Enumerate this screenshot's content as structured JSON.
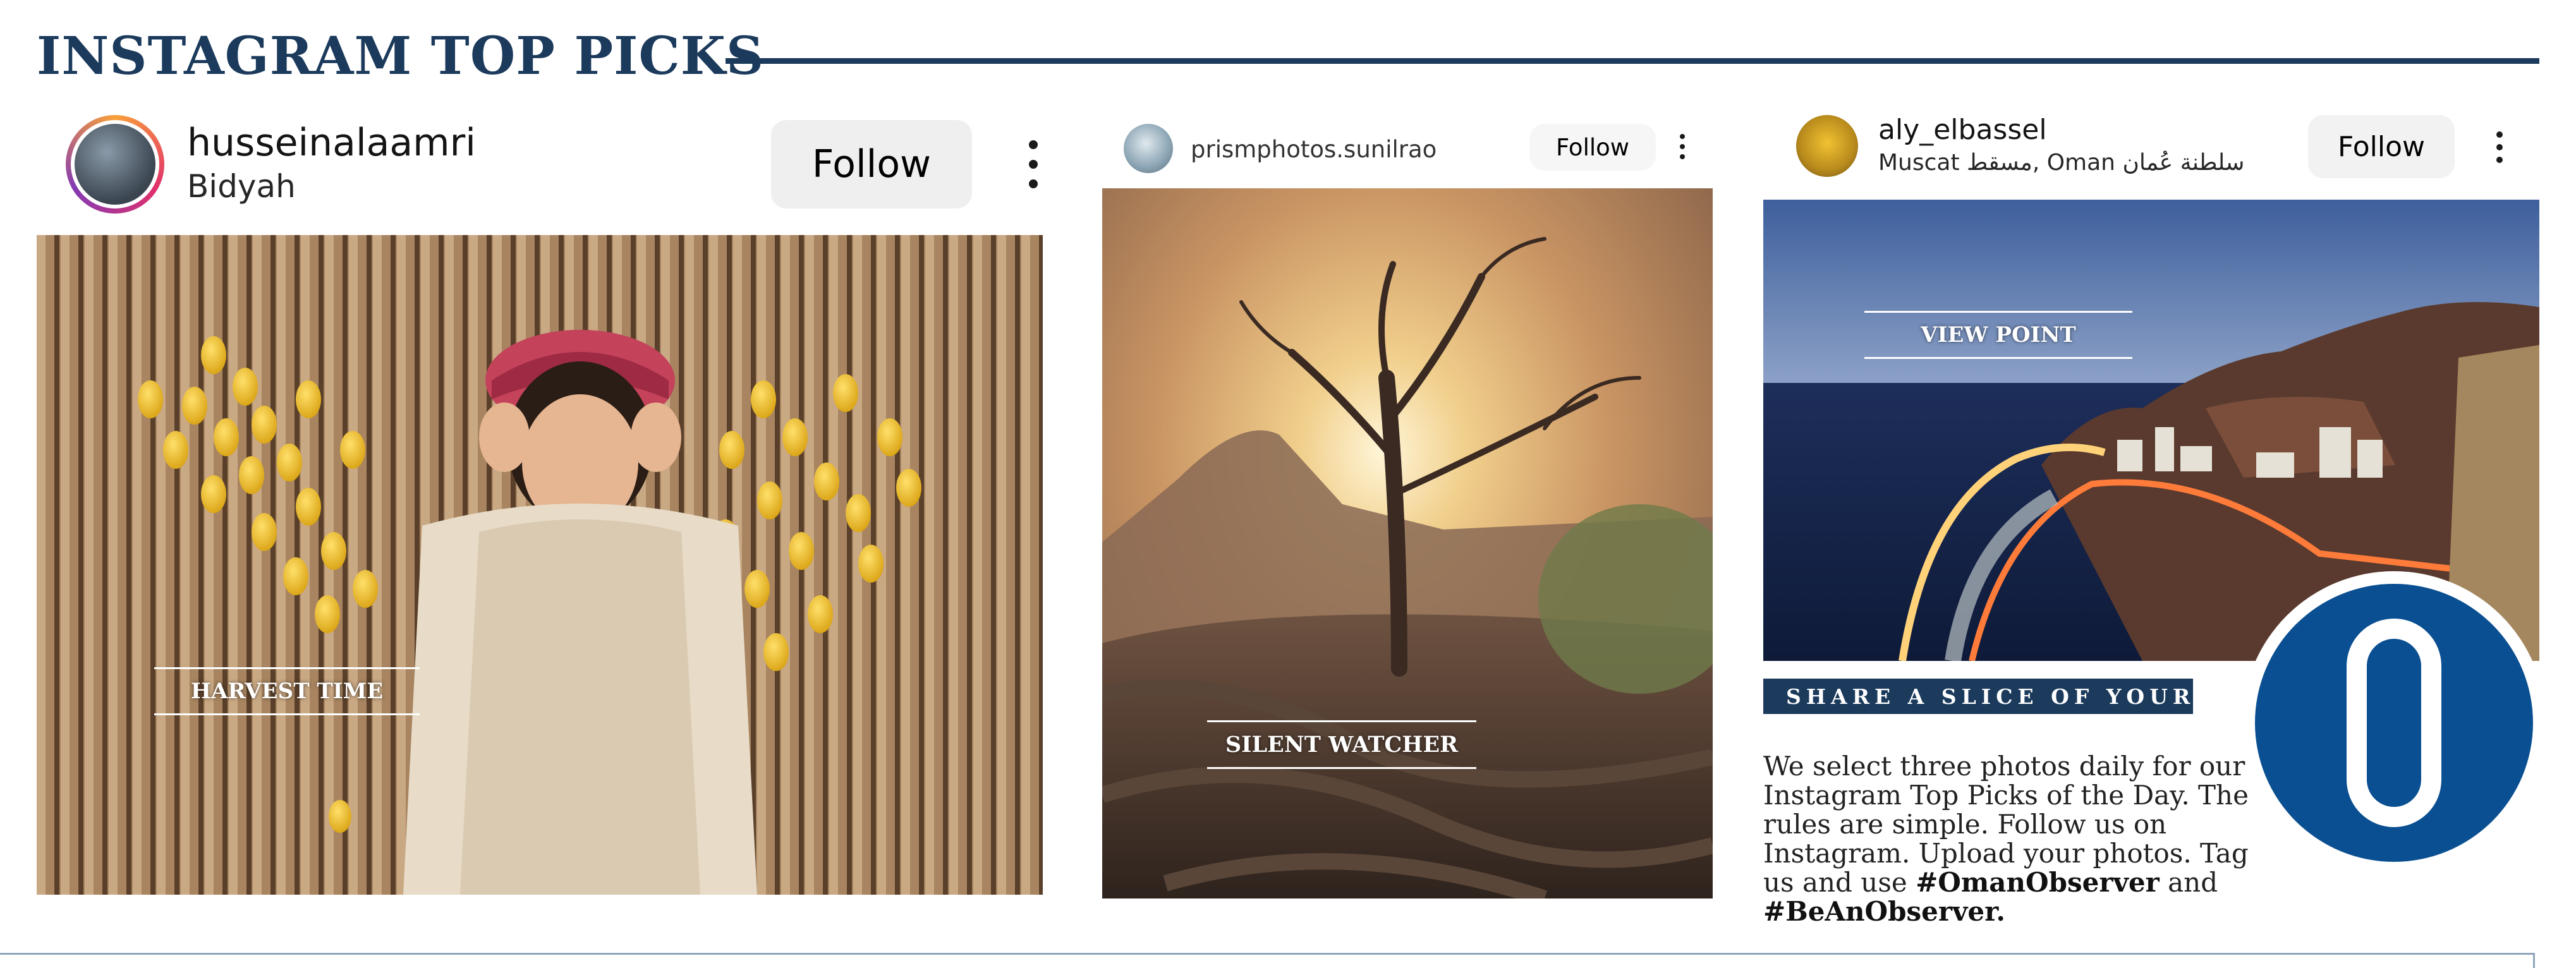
{
  "section": {
    "title": "INSTAGRAM TOP PICKS"
  },
  "posts": [
    {
      "username": "husseinalaamri",
      "location": "Bidyah",
      "follow_label": "Follow",
      "more_icon": "more-vertical-icon",
      "caption": "HARVEST TIME"
    },
    {
      "username": "prismphotos.sunilrao",
      "location": "",
      "follow_label": "Follow",
      "more_icon": "more-vertical-icon",
      "caption": "SILENT WATCHER"
    },
    {
      "username": "aly_elbassel",
      "location": "Muscat مسقط, Oman سلطنة عُمان",
      "follow_label": "Follow",
      "more_icon": "more-vertical-icon",
      "caption": "VIEW POINT"
    }
  ],
  "share": {
    "banner": "SHARE A SLICE OF YOUR LIFE",
    "body_1": "We select three photos daily for our Instagram Top Picks of the Day. The rules are simple. Follow us on Instagram. Upload your photos. Tag us and use ",
    "hashtag_1": "#OmanObserver",
    "body_2": " and ",
    "hashtag_2": "#BeAnObserver."
  },
  "logo": {
    "letter": "O",
    "color": "#0a4f91"
  },
  "colors": {
    "navy": "#1b3a5c",
    "follow_bg": "#efefef"
  }
}
